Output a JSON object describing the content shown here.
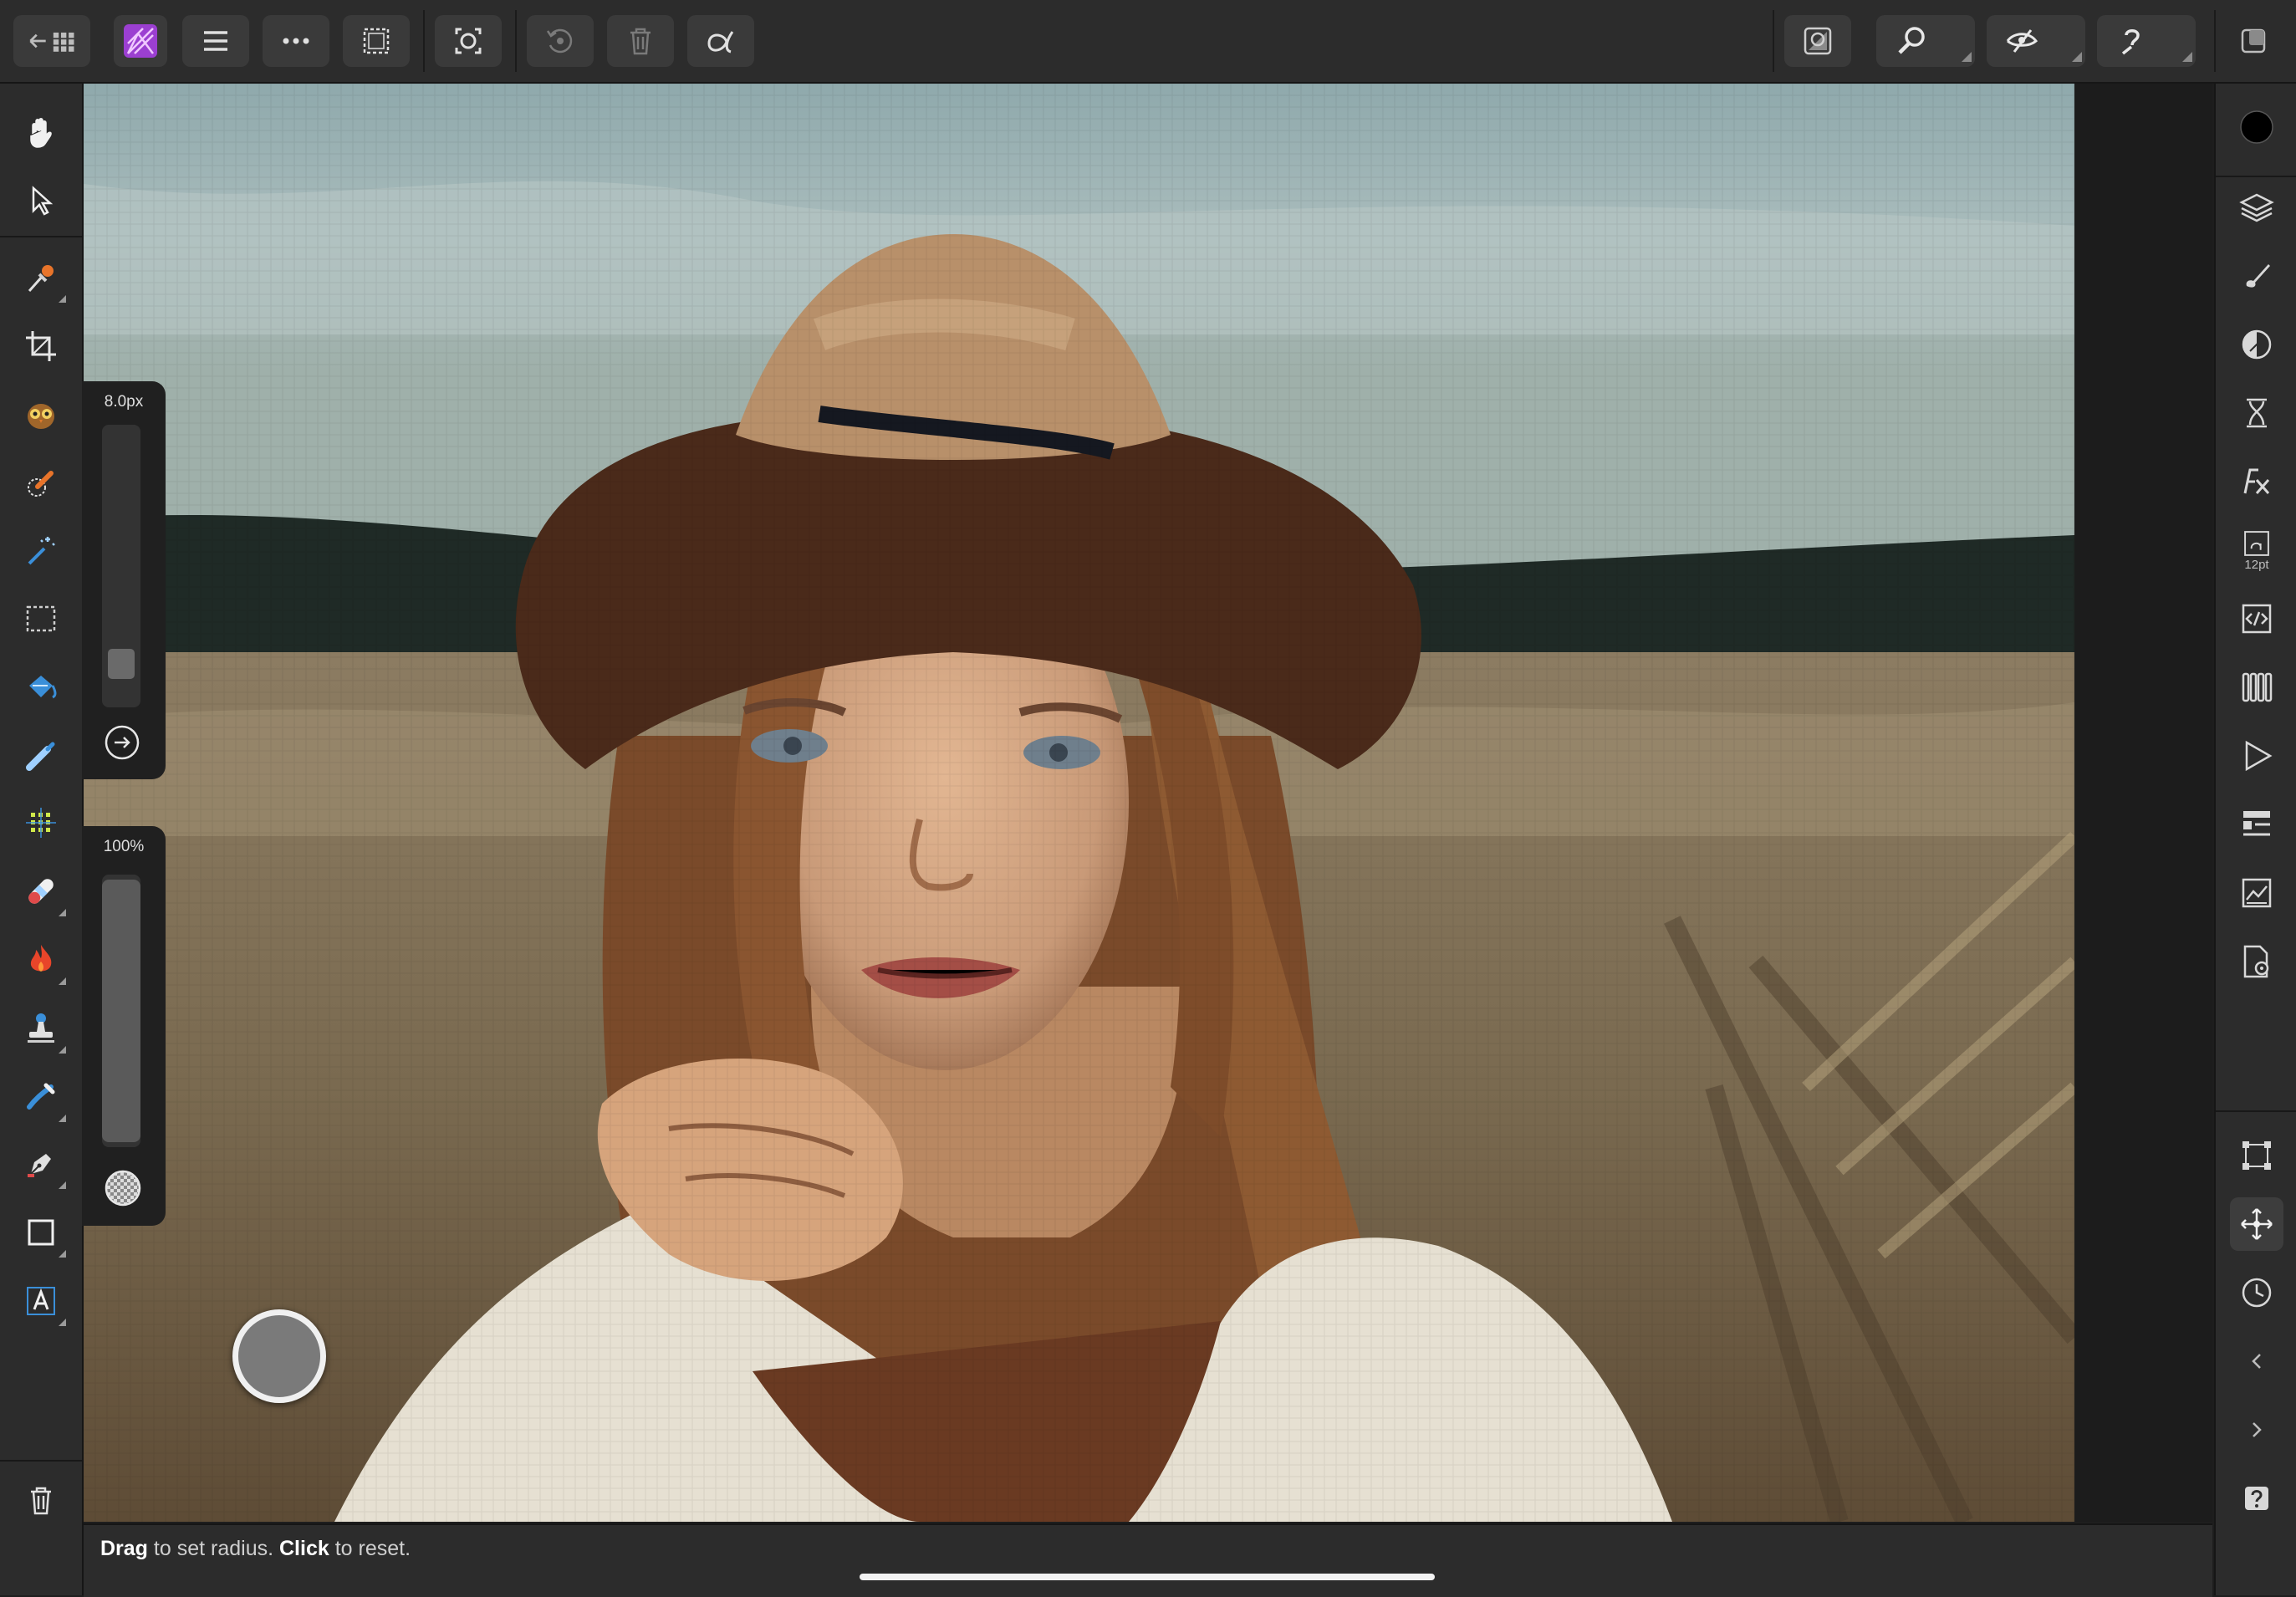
{
  "app": {
    "name": "Affinity Photo",
    "persona": "Photo Persona"
  },
  "top_toolbar": {
    "left": [
      "back-to-documents",
      "app-persona",
      "main-menu",
      "more-options",
      "selection-mode"
    ],
    "center": [
      "quick-mask",
      "history-undo",
      "delete",
      "snapping-alpha"
    ],
    "right": [
      "view-mode",
      "zoom",
      "view-options",
      "context-help",
      "split-view"
    ]
  },
  "tools": [
    "hand-tool",
    "move-tool",
    "color-picker-tool",
    "crop-tool",
    "red-eye-tool",
    "selection-brush-tool",
    "flood-select-tool",
    "marquee-tool",
    "fill-tool",
    "paint-brush-tool",
    "pixelate-tool",
    "healing-brush-tool",
    "burn-tool",
    "clone-tool",
    "smudge-tool",
    "pen-tool",
    "rectangle-tool",
    "text-tool",
    "trash"
  ],
  "brush_controls": {
    "size": {
      "label": "8.0px",
      "level": 0.1
    },
    "opacity": {
      "label": "100%",
      "level": 1.0
    }
  },
  "studio": {
    "panels": [
      "color",
      "layers",
      "brushes",
      "adjustments",
      "live-filters",
      "effects",
      "text-styles",
      "macros",
      "channels",
      "stock",
      "navigator",
      "swatches",
      "assets"
    ],
    "text_styles_caption": "12pt",
    "lower": [
      "transform",
      "snapping",
      "history",
      "collapse",
      "expand",
      "help"
    ]
  },
  "status": {
    "hint_parts": [
      "Drag",
      " to set radius. ",
      "Click",
      " to reset."
    ]
  },
  "colors": {
    "accent": "#ffffff",
    "persona_icon": "#9b3fd1",
    "ui_bg": "#2c2c2c",
    "primary_color": "#000000"
  }
}
